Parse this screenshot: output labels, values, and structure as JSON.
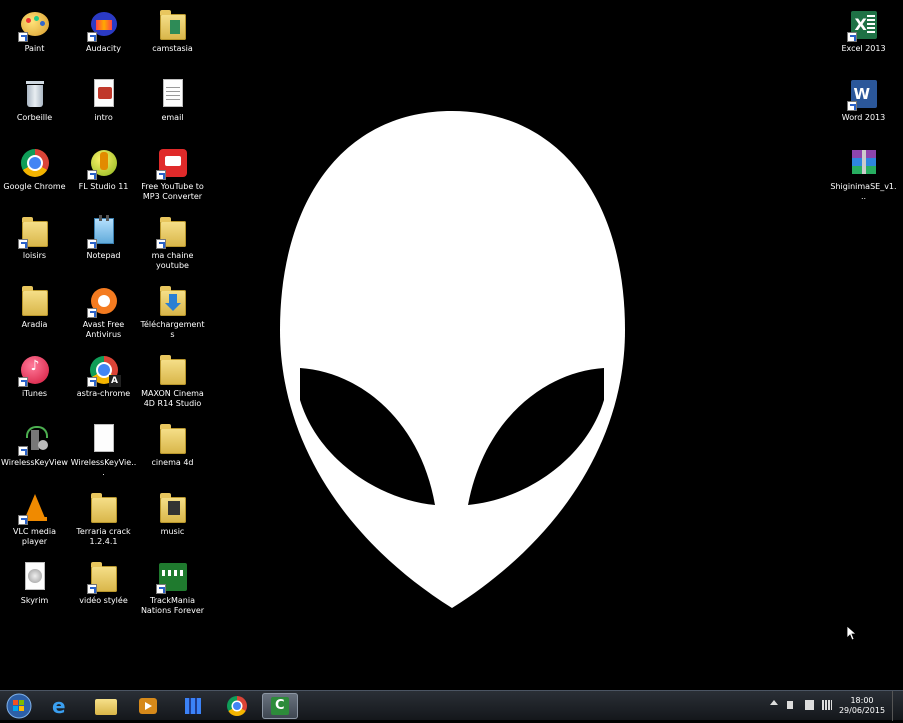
{
  "desktop": {
    "left_icons": [
      {
        "label": "Paint"
      },
      {
        "label": "Audacity"
      },
      {
        "label": "camstasia"
      },
      {
        "label": "Corbeille"
      },
      {
        "label": "intro"
      },
      {
        "label": "email"
      },
      {
        "label": "Google Chrome"
      },
      {
        "label": "FL Studio 11"
      },
      {
        "label": "Free YouTube to MP3 Converter"
      },
      {
        "label": "loisirs"
      },
      {
        "label": "Notepad"
      },
      {
        "label": "ma chaine youtube"
      },
      {
        "label": "Aradia"
      },
      {
        "label": "Avast Free Antivirus"
      },
      {
        "label": "Téléchargements"
      },
      {
        "label": "iTunes"
      },
      {
        "label": "astra-chrome"
      },
      {
        "label": "MAXON Cinema 4D R14 Studio"
      },
      {
        "label": "WirelessKeyView"
      },
      {
        "label": "WirelessKeyVie..."
      },
      {
        "label": "cinema 4d"
      },
      {
        "label": "VLC media player"
      },
      {
        "label": "Terraria crack 1.2.4.1"
      },
      {
        "label": "music"
      },
      {
        "label": "Skyrim"
      },
      {
        "label": "vidéo stylée"
      },
      {
        "label": "TrackMania Nations Forever"
      }
    ],
    "right_icons": [
      {
        "label": "Excel 2013"
      },
      {
        "label": "Word 2013"
      },
      {
        "label": "ShiginimaSE_v1..."
      }
    ]
  },
  "taskbar": {
    "items": [
      {
        "name": "internet-explorer"
      },
      {
        "name": "file-explorer"
      },
      {
        "name": "media-player"
      },
      {
        "name": "app-grid"
      },
      {
        "name": "google-chrome"
      },
      {
        "name": "camtasia",
        "active": true
      }
    ],
    "clock": {
      "time": "18:00",
      "date": "29/06/2015"
    }
  },
  "colors": {
    "background": "#000000",
    "alien_head": "#ffffff"
  }
}
